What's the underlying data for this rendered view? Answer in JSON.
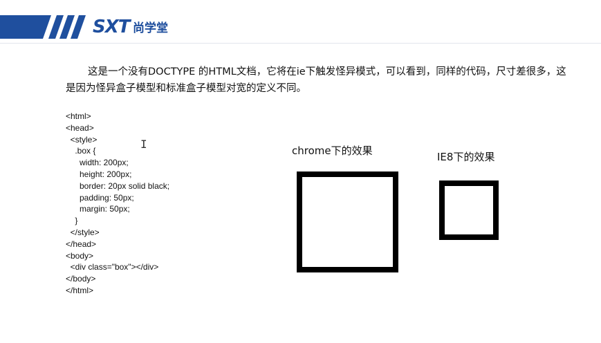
{
  "header": {
    "logo_text": "SXT",
    "logo_cn": "尚学堂"
  },
  "content": {
    "intro": "这是一个没有DOCTYPE 的HTML文档，它将在ie下触发怪异模式，可以看到，同样的代码，尺寸差很多，这是因为怪异盒子模型和标准盒子模型对宽的定义不同。",
    "code_lines": [
      "<html>",
      "<head>",
      "  <style>",
      "    .box {",
      "      width: 200px;",
      "      height: 200px;",
      "      border: 20px solid black;",
      "      padding: 50px;",
      "      margin: 50px;",
      "    }",
      "  </style>",
      "</head>",
      "<body>",
      "  <div class=\"box\"></div>",
      "</body>",
      "</html>"
    ],
    "cursor_glyph": "I",
    "chrome_label": "chrome下的效果",
    "ie8_label": "IE8下的效果"
  },
  "colors": {
    "brand_blue": "#1f4f9e",
    "box_border": "#000000"
  }
}
